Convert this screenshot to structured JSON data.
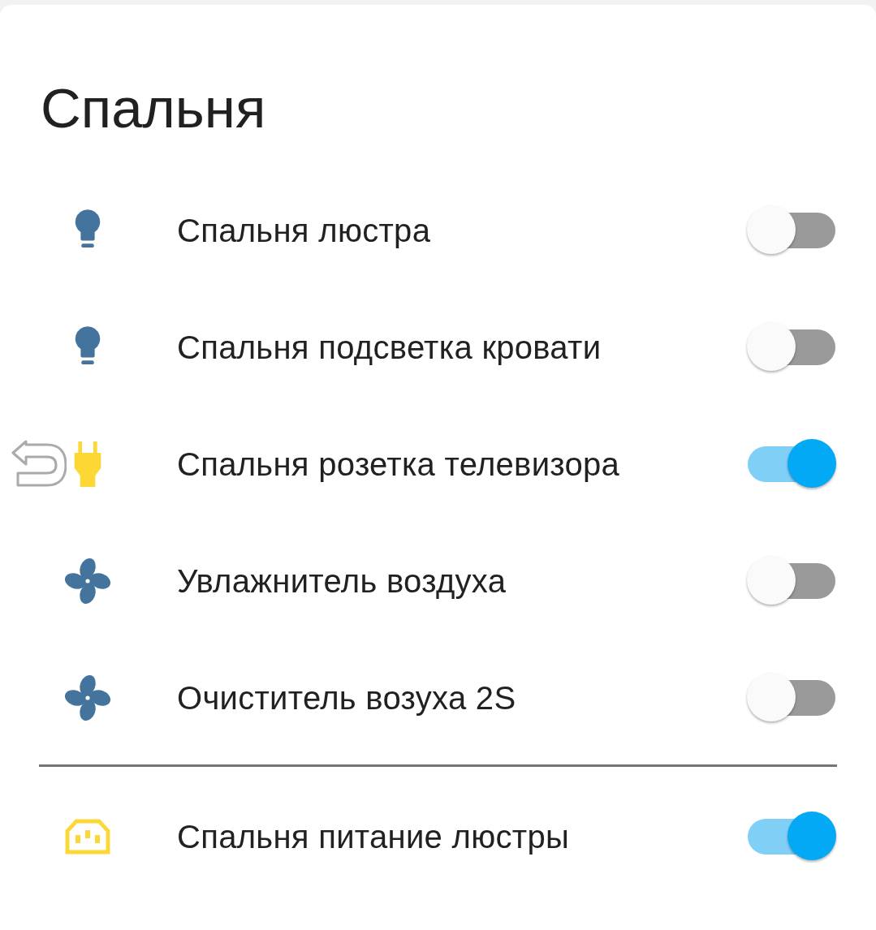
{
  "card": {
    "title": "Спальня",
    "entities": [
      {
        "name": "Спальня люстра",
        "kind": "bulb",
        "on": false,
        "back_arrow": false
      },
      {
        "name": "Спальня подсветка кровати",
        "kind": "bulb",
        "on": false,
        "back_arrow": false
      },
      {
        "name": "Спальня розетка телевизора",
        "kind": "plug",
        "on": true,
        "back_arrow": true
      },
      {
        "name": "Увлажнитель воздуха",
        "kind": "fan",
        "on": false,
        "back_arrow": false
      },
      {
        "name": "Очиститель возуха 2S",
        "kind": "fan",
        "on": false,
        "back_arrow": false
      }
    ],
    "footer_entities": [
      {
        "name": "Спальня питание люстры",
        "kind": "socket",
        "on": true,
        "back_arrow": false
      }
    ]
  }
}
